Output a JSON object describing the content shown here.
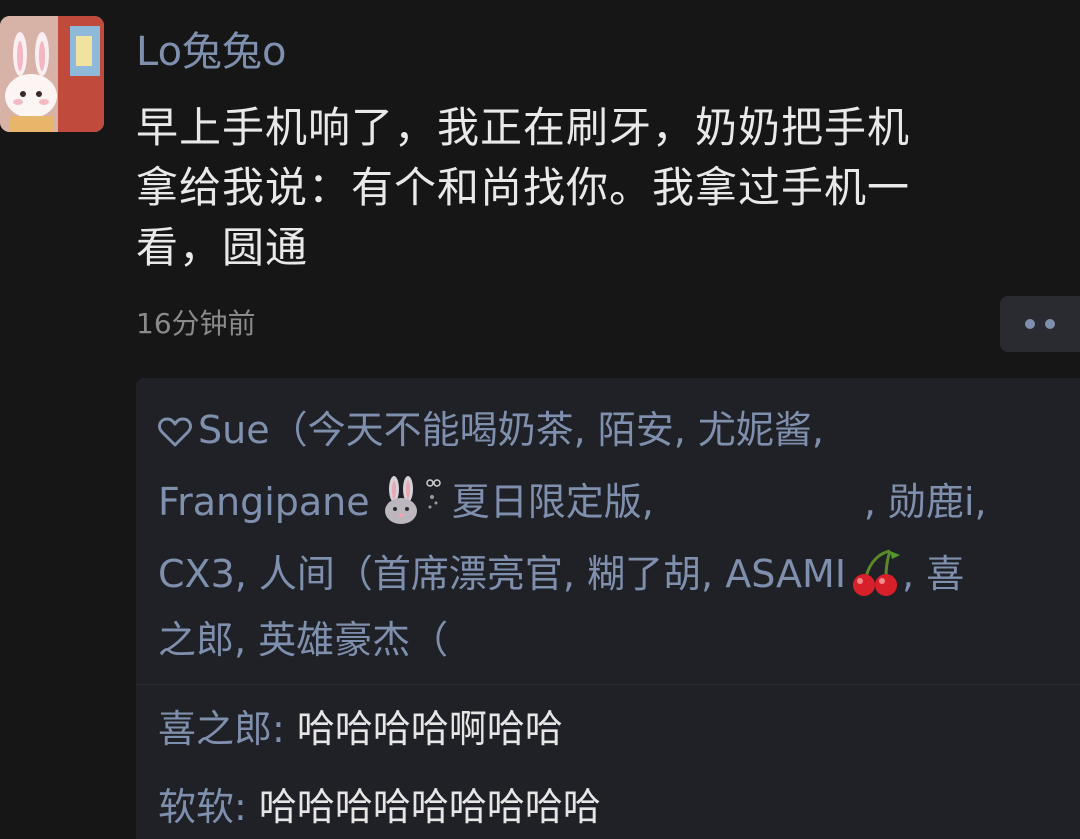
{
  "post": {
    "username": "Lo兔兔o",
    "text_lines": [
      "早上手机响了，我正在刷牙，奶奶把手机",
      "拿给我说：有个和尚找你。我拿过手机一",
      "看，圆通"
    ],
    "timestamp": "16分钟前"
  },
  "likes": {
    "icon": "heart-outline-icon",
    "row1": "Sue（今天不能喝奶茶, 陌安, 尤妮酱,",
    "row2_a": "Frangipane",
    "row2_b": "夏日限定版,",
    "row2_c": ", 勋鹿i,",
    "row3_a": "CX3, 人间（首席漂亮官, 糊了胡, ASAMI",
    "row3_b": ", 喜",
    "row4": "之郎, 英雄豪杰（"
  },
  "comments": [
    {
      "author": "喜之郎",
      "sep": ": ",
      "body": "哈哈哈哈啊哈哈"
    },
    {
      "author": "软软",
      "sep": ": ",
      "body": "哈哈哈哈哈哈哈哈哈"
    }
  ],
  "colors": {
    "background": "#161616",
    "panel": "#202126",
    "name_blue": "#7f8fae",
    "text": "#e9e9e9",
    "muted": "#8a8a8a"
  }
}
